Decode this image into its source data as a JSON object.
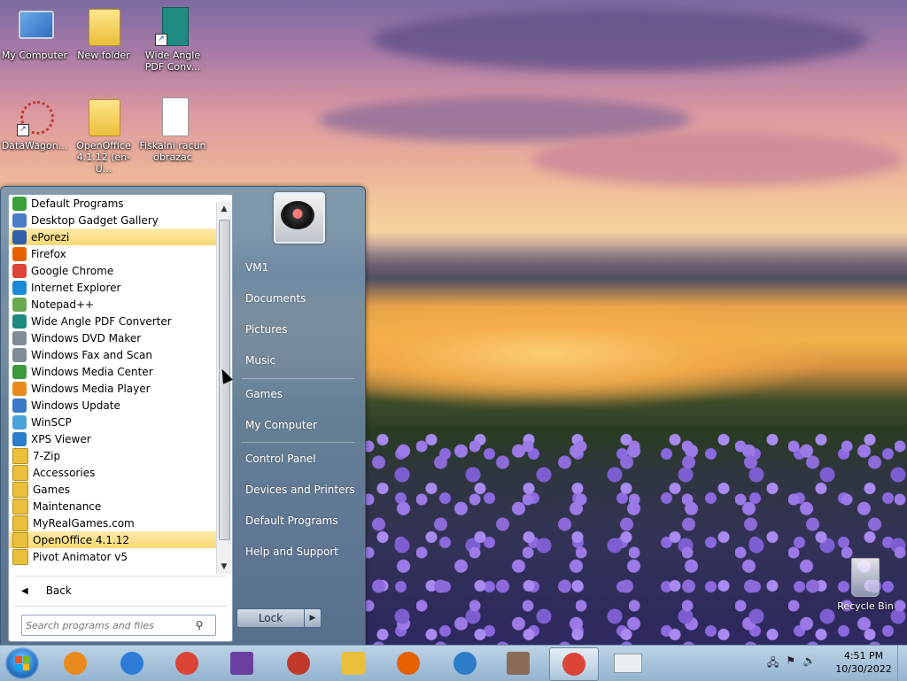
{
  "desktop": {
    "icons": [
      {
        "label": "My Computer",
        "icon": "computer-icon"
      },
      {
        "label": "New folder",
        "icon": "folder-icon"
      },
      {
        "label": "Wide Angle\nPDF Conv...",
        "icon": "pdf-converter-icon"
      },
      {
        "label": "DataWagon...",
        "icon": "datawagon-icon"
      },
      {
        "label": "OpenOffice\n4.1.12 (en-U...",
        "icon": "folder-icon"
      },
      {
        "label": "Fiskalni racun\nobrazac",
        "icon": "document-icon"
      }
    ],
    "recycle_bin": "Recycle Bin"
  },
  "start_menu": {
    "programs": [
      {
        "label": "Default Programs",
        "icon": "default-programs-icon",
        "color": "#3aa03a",
        "highlighted": false
      },
      {
        "label": "Desktop Gadget Gallery",
        "icon": "gadget-gallery-icon",
        "color": "#4a7cc8",
        "highlighted": false
      },
      {
        "label": "ePorezi",
        "icon": "eporezi-icon",
        "color": "#2f5fa8",
        "highlighted": true
      },
      {
        "label": "Firefox",
        "icon": "firefox-icon",
        "color": "#e66000",
        "highlighted": false
      },
      {
        "label": "Google Chrome",
        "icon": "chrome-icon",
        "color": "#db4437",
        "highlighted": false
      },
      {
        "label": "Internet Explorer",
        "icon": "internet-explorer-icon",
        "color": "#1b8ad6",
        "highlighted": false
      },
      {
        "label": "Notepad++",
        "icon": "notepad-icon",
        "color": "#6aa84f",
        "highlighted": false
      },
      {
        "label": "Wide Angle PDF Converter",
        "icon": "pdf-converter-icon",
        "color": "#1e8a80",
        "highlighted": false
      },
      {
        "label": "Windows DVD Maker",
        "icon": "dvd-maker-icon",
        "color": "#7f8b96",
        "highlighted": false
      },
      {
        "label": "Windows Fax and Scan",
        "icon": "fax-scan-icon",
        "color": "#7f8b96",
        "highlighted": false
      },
      {
        "label": "Windows Media Center",
        "icon": "media-center-icon",
        "color": "#3c9a3c",
        "highlighted": false
      },
      {
        "label": "Windows Media Player",
        "icon": "media-player-icon",
        "color": "#e98b1c",
        "highlighted": false
      },
      {
        "label": "Windows Update",
        "icon": "windows-update-icon",
        "color": "#3a78c8",
        "highlighted": false
      },
      {
        "label": "WinSCP",
        "icon": "winscp-icon",
        "color": "#4aa3d8",
        "highlighted": false
      },
      {
        "label": "XPS Viewer",
        "icon": "xps-viewer-icon",
        "color": "#2d7cc8",
        "highlighted": false
      },
      {
        "label": "7-Zip",
        "icon": "folder-icon",
        "color": "#e9bf3c",
        "highlighted": false
      },
      {
        "label": "Accessories",
        "icon": "folder-icon",
        "color": "#e9bf3c",
        "highlighted": false
      },
      {
        "label": "Games",
        "icon": "folder-icon",
        "color": "#e9bf3c",
        "highlighted": false
      },
      {
        "label": "Maintenance",
        "icon": "folder-icon",
        "color": "#e9bf3c",
        "highlighted": false
      },
      {
        "label": "MyRealGames.com",
        "icon": "folder-icon",
        "color": "#e9bf3c",
        "highlighted": false
      },
      {
        "label": "OpenOffice 4.1.12",
        "icon": "folder-icon",
        "color": "#e9bf3c",
        "highlighted": true
      },
      {
        "label": "Pivot Animator v5",
        "icon": "folder-icon",
        "color": "#e9bf3c",
        "highlighted": false
      }
    ],
    "back_label": "Back",
    "search_placeholder": "Search programs and files",
    "right_links": [
      {
        "label": "VM1"
      },
      {
        "label": "Documents"
      },
      {
        "label": "Pictures"
      },
      {
        "label": "Music"
      },
      {
        "label": "Games"
      },
      {
        "label": "My Computer"
      },
      {
        "label": "Control Panel"
      },
      {
        "label": "Devices and Printers"
      },
      {
        "label": "Default Programs"
      },
      {
        "label": "Help and Support"
      }
    ],
    "lock_label": "Lock"
  },
  "taskbar": {
    "buttons": [
      {
        "icon": "media-player-icon",
        "color": "#e98b1c",
        "active": false
      },
      {
        "icon": "openoffice-icon",
        "color": "#2f7cd6",
        "active": false
      },
      {
        "icon": "chrome-icon",
        "color": "#db4437",
        "active": false
      },
      {
        "icon": "mahjong-icon",
        "color": "#6b3fa0",
        "active": false
      },
      {
        "icon": "pivot-animator-icon",
        "color": "#c0392b",
        "active": false
      },
      {
        "icon": "file-explorer-icon",
        "color": "#e9bf3c",
        "active": false
      },
      {
        "icon": "firefox-icon",
        "color": "#e66000",
        "active": false
      },
      {
        "icon": "xps-viewer-icon",
        "color": "#2d7cc8",
        "active": false
      },
      {
        "icon": "photo-viewer-icon",
        "color": "#8a6b55",
        "active": false
      },
      {
        "icon": "chrome-icon",
        "color": "#db4437",
        "active": true
      },
      {
        "icon": "mail-icon",
        "color": "#e9eef3",
        "active": false
      }
    ],
    "tray_icons": [
      "network-icon",
      "action-center-icon",
      "volume-icon"
    ],
    "time": "4:51 PM",
    "date": "10/30/2022"
  }
}
